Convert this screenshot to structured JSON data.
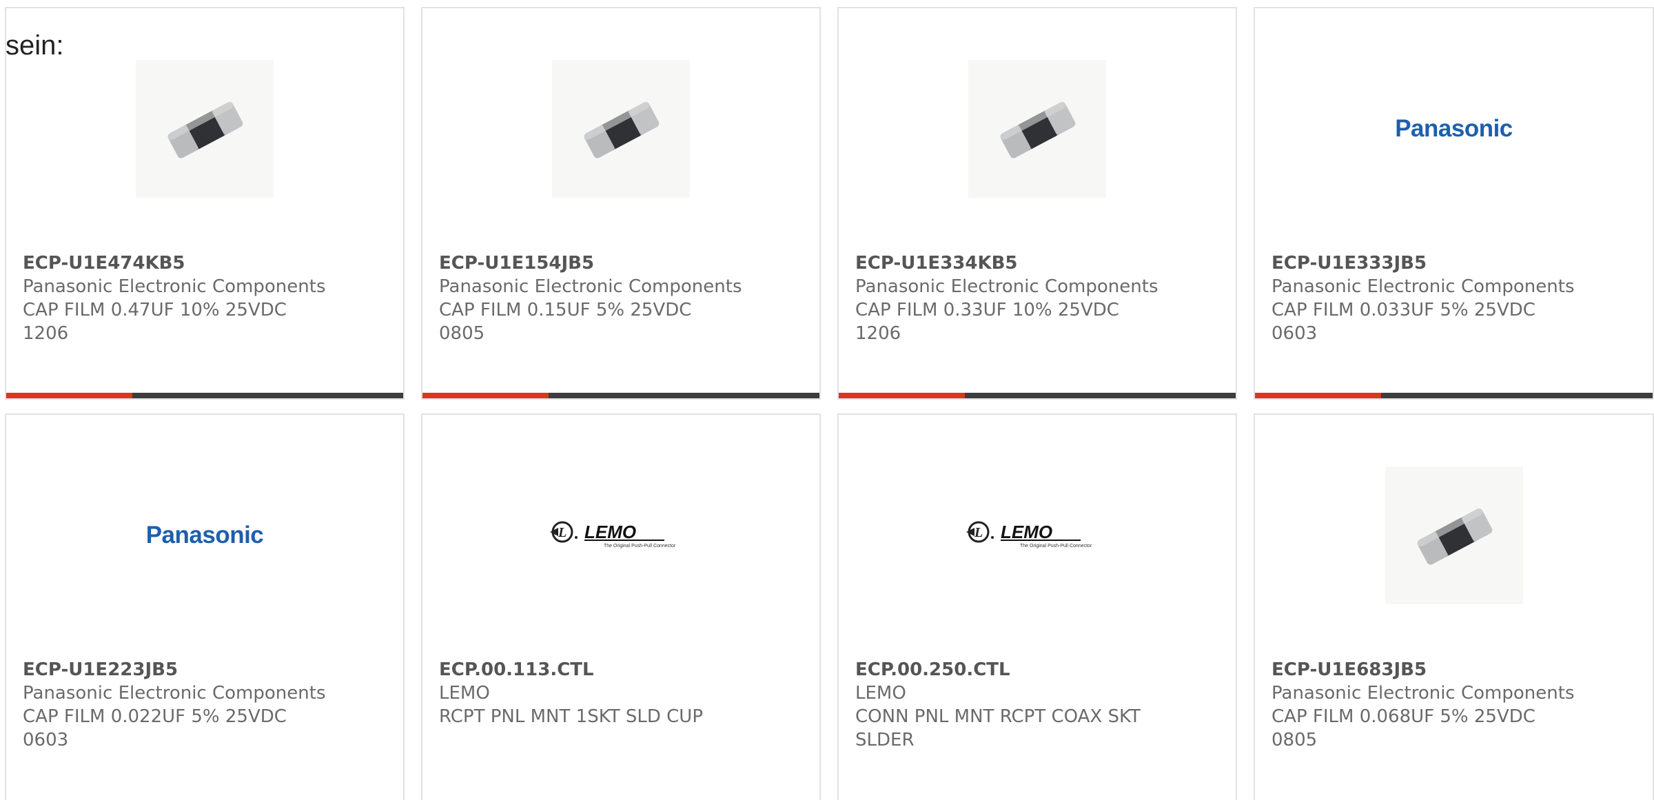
{
  "intro_text": "sein:",
  "colors": {
    "accent": "#d9381e",
    "bar": "#3d3d3d",
    "panasonic_blue": "#1d5fae"
  },
  "products": [
    {
      "image": "chip-capacitor",
      "part_number": "ECP-U1E474KB5",
      "manufacturer": "Panasonic Electronic Components",
      "description": [
        "CAP FILM 0.47UF 10% 25VDC",
        "1206"
      ]
    },
    {
      "image": "chip-capacitor",
      "part_number": "ECP-U1E154JB5",
      "manufacturer": "Panasonic Electronic Components",
      "description": [
        "CAP FILM 0.15UF 5% 25VDC",
        "0805"
      ]
    },
    {
      "image": "chip-capacitor",
      "part_number": "ECP-U1E334KB5",
      "manufacturer": "Panasonic Electronic Components",
      "description": [
        "CAP FILM 0.33UF 10% 25VDC",
        "1206"
      ]
    },
    {
      "image": "panasonic-logo",
      "logo_text": "Panasonic",
      "part_number": "ECP-U1E333JB5",
      "manufacturer": "Panasonic Electronic Components",
      "description": [
        "CAP FILM 0.033UF 5% 25VDC",
        "0603"
      ]
    },
    {
      "image": "panasonic-logo",
      "logo_text": "Panasonic",
      "part_number": "ECP-U1E223JB5",
      "manufacturer": "Panasonic Electronic Components",
      "description": [
        "CAP FILM 0.022UF 5% 25VDC",
        "0603"
      ]
    },
    {
      "image": "lemo-logo",
      "logo_text": "LEMO",
      "logo_tagline": "The Original Push-Pull Connector",
      "part_number": "ECP.00.113.CTL",
      "manufacturer": "LEMO",
      "description": [
        "RCPT PNL MNT 1SKT SLD CUP"
      ]
    },
    {
      "image": "lemo-logo",
      "logo_text": "LEMO",
      "logo_tagline": "The Original Push-Pull Connector",
      "part_number": "ECP.00.250.CTL",
      "manufacturer": "LEMO",
      "description": [
        "CONN PNL MNT RCPT COAX SKT",
        "SLDER"
      ]
    },
    {
      "image": "chip-capacitor",
      "part_number": "ECP-U1E683JB5",
      "manufacturer": "Panasonic Electronic Components",
      "description": [
        "CAP FILM 0.068UF 5% 25VDC",
        "0805"
      ]
    }
  ]
}
